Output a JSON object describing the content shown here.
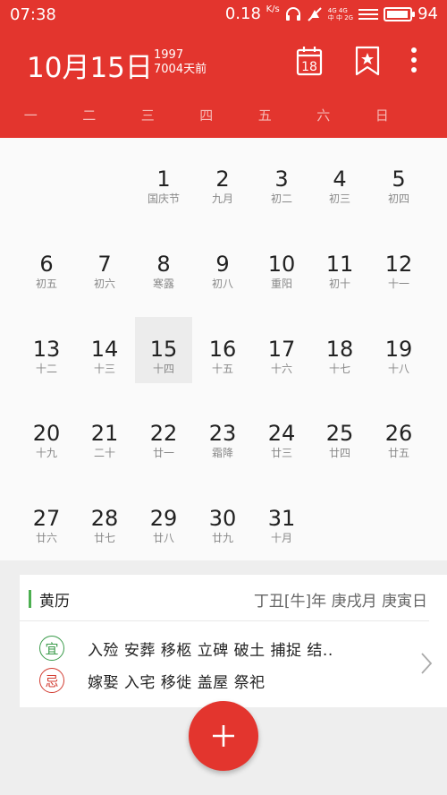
{
  "status": {
    "time": "07:38",
    "speed": "0.18",
    "speed_unit": "K/s",
    "net_label_top": "4G 4G",
    "net_label_bottom": "中 中 2G",
    "battery": "94",
    "battery_level": 0.94
  },
  "header": {
    "date": "10月15日",
    "year": "1997",
    "days_ago": "7004天前",
    "today_icon_number": "18"
  },
  "weekdays": [
    "一",
    "二",
    "三",
    "四",
    "五",
    "六",
    "日"
  ],
  "calendar": {
    "days": [
      {
        "num": "1",
        "lunar": "国庆节"
      },
      {
        "num": "2",
        "lunar": "九月"
      },
      {
        "num": "3",
        "lunar": "初二"
      },
      {
        "num": "4",
        "lunar": "初三"
      },
      {
        "num": "5",
        "lunar": "初四"
      },
      {
        "num": "6",
        "lunar": "初五"
      },
      {
        "num": "7",
        "lunar": "初六"
      },
      {
        "num": "8",
        "lunar": "寒露"
      },
      {
        "num": "9",
        "lunar": "初八"
      },
      {
        "num": "10",
        "lunar": "重阳"
      },
      {
        "num": "11",
        "lunar": "初十"
      },
      {
        "num": "12",
        "lunar": "十一"
      },
      {
        "num": "13",
        "lunar": "十二"
      },
      {
        "num": "14",
        "lunar": "十三"
      },
      {
        "num": "15",
        "lunar": "十四"
      },
      {
        "num": "16",
        "lunar": "十五"
      },
      {
        "num": "17",
        "lunar": "十六"
      },
      {
        "num": "18",
        "lunar": "十七"
      },
      {
        "num": "19",
        "lunar": "十八"
      },
      {
        "num": "20",
        "lunar": "十九"
      },
      {
        "num": "21",
        "lunar": "二十"
      },
      {
        "num": "22",
        "lunar": "廿一"
      },
      {
        "num": "23",
        "lunar": "霜降"
      },
      {
        "num": "24",
        "lunar": "廿三"
      },
      {
        "num": "25",
        "lunar": "廿四"
      },
      {
        "num": "26",
        "lunar": "廿五"
      },
      {
        "num": "27",
        "lunar": "廿六"
      },
      {
        "num": "28",
        "lunar": "廿七"
      },
      {
        "num": "29",
        "lunar": "廿八"
      },
      {
        "num": "30",
        "lunar": "廿九"
      },
      {
        "num": "31",
        "lunar": "十月"
      }
    ]
  },
  "almanac": {
    "title": "黄历",
    "ganzhi": "丁丑[牛]年 庚戌月 庚寅日",
    "good_label": "宜",
    "good_items": "入殓  安葬  移柩  立碑  破土  捕捉  结..",
    "bad_label": "忌",
    "bad_items": "嫁娶  入宅  移徙  盖屋  祭祀"
  },
  "colors": {
    "primary": "#e3352e",
    "good": "#3a9b4a",
    "bad": "#d23b30"
  }
}
